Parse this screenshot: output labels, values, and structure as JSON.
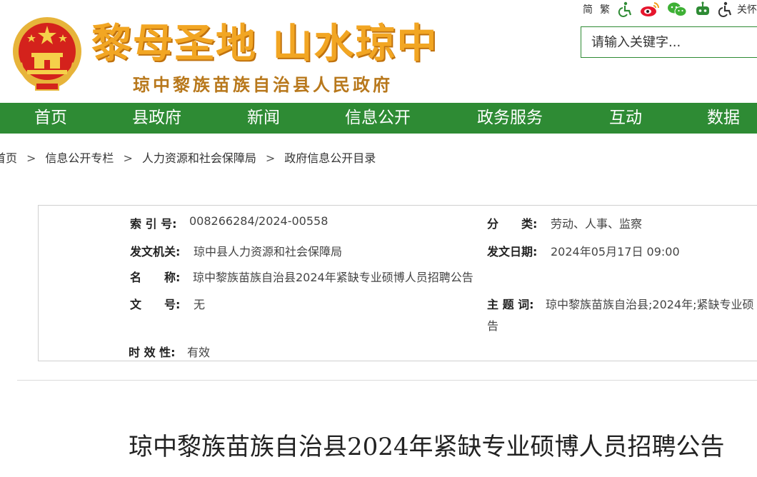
{
  "header": {
    "slogan": "黎母圣地 山水琼中",
    "gov_name": "琼中黎族苗族自治县人民政府",
    "topbar": {
      "simplified": "简",
      "traditional": "繁",
      "care": "关怀"
    },
    "search": {
      "placeholder": "请输入关键字..."
    }
  },
  "nav": {
    "items": [
      "首页",
      "县政府",
      "新闻",
      "信息公开",
      "政务服务",
      "互动",
      "数据"
    ]
  },
  "breadcrumb": [
    "首页",
    "信息公开专栏",
    "人力资源和社会保障局",
    "政府信息公开目录"
  ],
  "info": {
    "index_label": "索 引 号:",
    "index_value": "008266284/2024-00558",
    "category_label": "分　　类:",
    "category_value": "劳动、人事、监察",
    "issuer_label": "发文机关:",
    "issuer_value": "琼中县人力资源和社会保障局",
    "date_label": "发文日期:",
    "date_value": "2024年05月17日 09:00",
    "name_label": "名　　称:",
    "name_value": "琼中黎族苗族自治县2024年紧缺专业硕博人员招聘公告",
    "docno_label": "文　　号:",
    "docno_value": "无",
    "subject_label": "主 题 词:",
    "subject_value_line1": "琼中黎族苗族自治县;2024年;紧缺专业硕",
    "subject_value_line2": "告",
    "validity_label": "时 效 性:",
    "validity_value": "有效"
  },
  "article": {
    "title": "琼中黎族苗族自治县2024年紧缺专业硕博人员招聘公告"
  },
  "colors": {
    "nav_green": "#2e8b34",
    "slogan_orange": "#f2a623",
    "gov_name_brown": "#b8781c",
    "emblem_red": "#d4221c"
  }
}
